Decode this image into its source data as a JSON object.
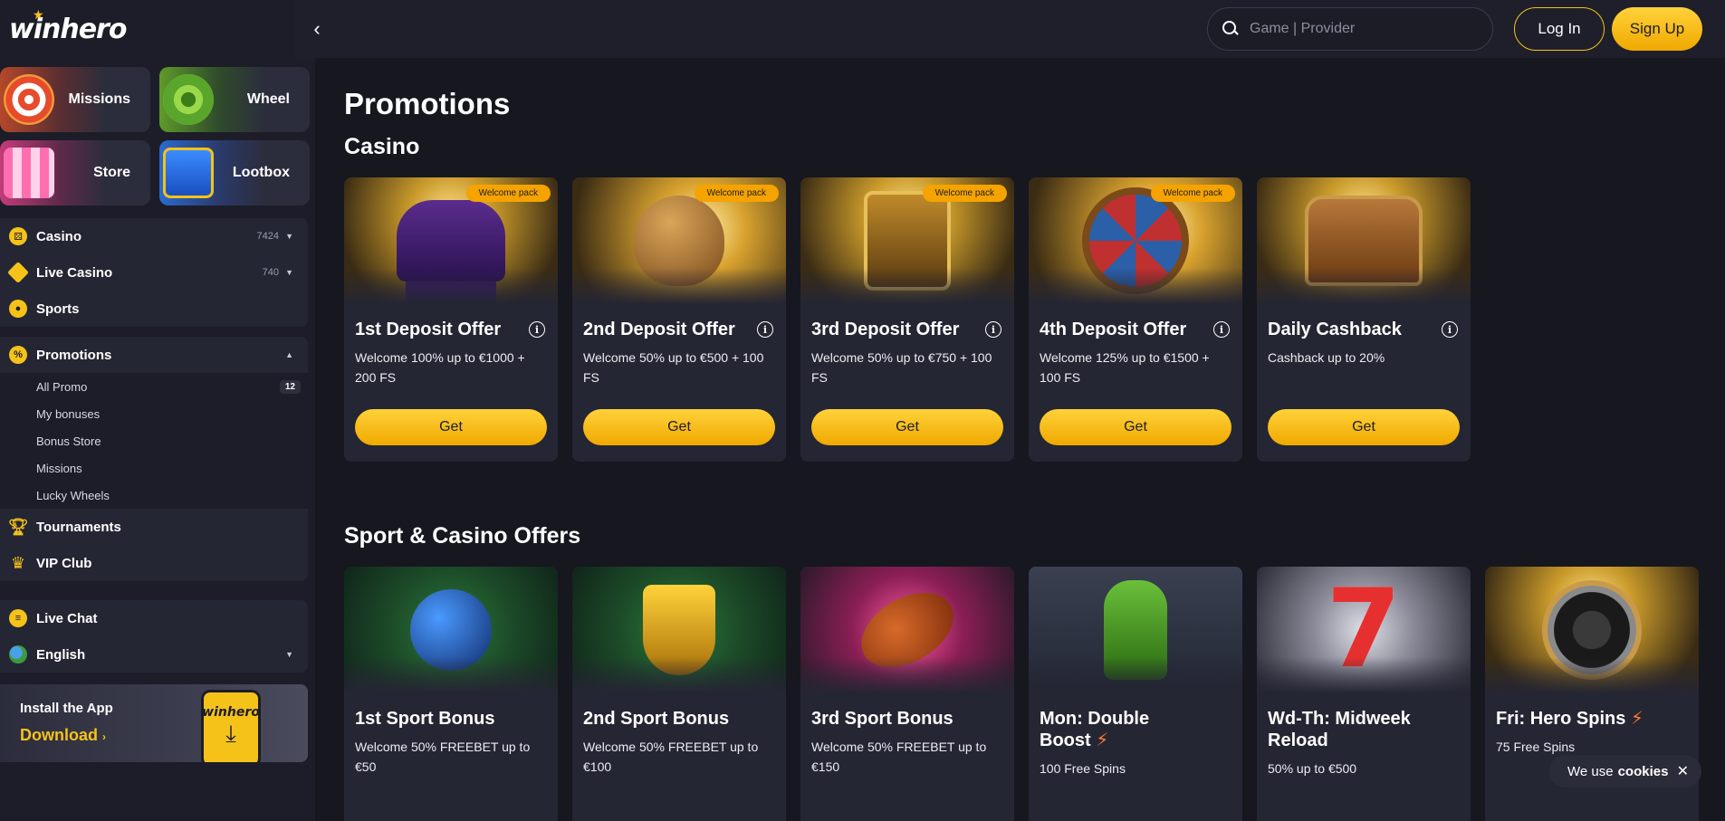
{
  "brand": {
    "logo": "winhero",
    "accent": "#f5c21a"
  },
  "quick_links": [
    {
      "label": "Missions",
      "icon": "target-icon"
    },
    {
      "label": "Wheel",
      "icon": "wheel-icon"
    },
    {
      "label": "Store",
      "icon": "store-icon"
    },
    {
      "label": "Lootbox",
      "icon": "lootbox-icon"
    }
  ],
  "nav": {
    "casino": {
      "label": "Casino",
      "count": "7424"
    },
    "live_casino": {
      "label": "Live Casino",
      "count": "740"
    },
    "sports": {
      "label": "Sports"
    },
    "promotions": {
      "label": "Promotions",
      "items": [
        {
          "label": "All Promo",
          "badge": "12"
        },
        {
          "label": "My bonuses"
        },
        {
          "label": "Bonus Store"
        },
        {
          "label": "Missions"
        },
        {
          "label": "Lucky Wheels"
        }
      ]
    },
    "tournaments": {
      "label": "Tournaments"
    },
    "vip": {
      "label": "VIP Club"
    },
    "live_chat": {
      "label": "Live Chat"
    },
    "language": {
      "label": "English"
    }
  },
  "install": {
    "title": "Install the App",
    "link": "Download",
    "phone_logo": "winhero"
  },
  "header": {
    "search_placeholder": "Game | Provider",
    "login": "Log In",
    "signup": "Sign Up"
  },
  "page": {
    "title": "Promotions",
    "casino_section": "Casino",
    "sport_section": "Sport & Casino Offers"
  },
  "casino_cards": [
    {
      "badge": "Welcome pack",
      "title": "1st Deposit Offer",
      "desc": "Welcome 100% up to €1000 + 200 FS",
      "button": "Get"
    },
    {
      "badge": "Welcome pack",
      "title": "2nd Deposit Offer",
      "desc": "Welcome 50% up to €500 + 100 FS",
      "button": "Get"
    },
    {
      "badge": "Welcome pack",
      "title": "3rd Deposit Offer",
      "desc": "Welcome 50% up to €750 + 100 FS",
      "button": "Get"
    },
    {
      "badge": "Welcome pack",
      "title": "4th Deposit Offer",
      "desc": "Welcome 125% up to €1500 + 100 FS",
      "button": "Get"
    },
    {
      "badge": "",
      "title": "Daily Cashback",
      "desc": "Cashback up to 20%",
      "button": "Get"
    }
  ],
  "sport_cards": [
    {
      "title": "1st Sport Bonus",
      "desc": "Welcome 50% FREEBET up to €50"
    },
    {
      "title": "2nd Sport Bonus",
      "desc": "Welcome 50% FREEBET up to €100"
    },
    {
      "title": "3rd Sport Bonus",
      "desc": "Welcome 50% FREEBET up to €150"
    },
    {
      "title": "Mon: Double Boost",
      "desc": "100 Free Spins"
    },
    {
      "title": "Wd-Th: Midweek Reload",
      "desc": "50% up to €500"
    },
    {
      "title": "Fri: Hero Spins",
      "desc": "75 Free Spins"
    }
  ],
  "cookie": {
    "text": "We use",
    "bold": "cookies",
    "close": "✕"
  }
}
